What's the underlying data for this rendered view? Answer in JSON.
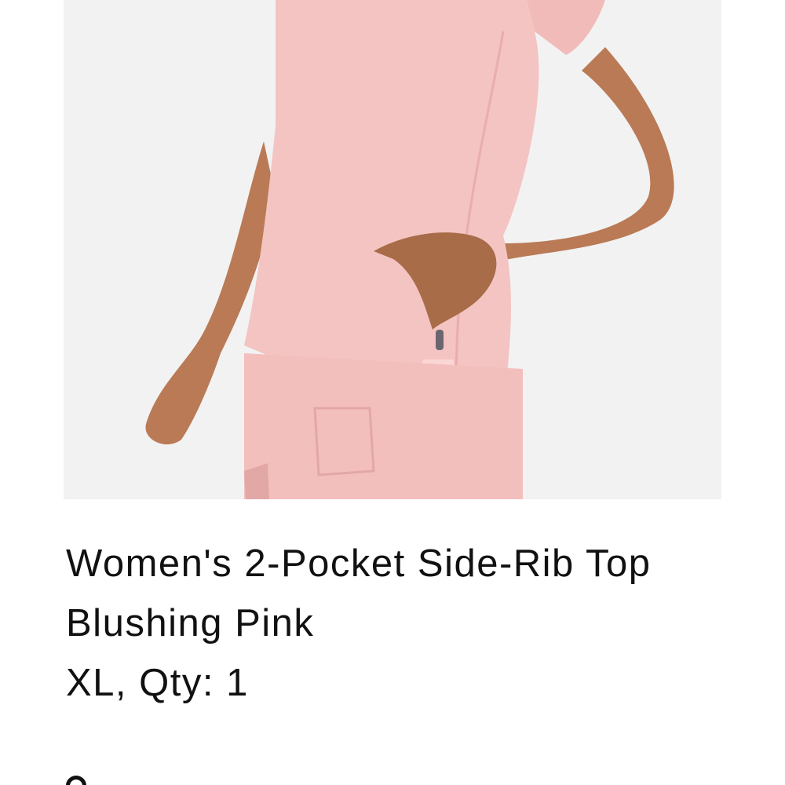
{
  "product": {
    "title": "Women's 2-Pocket Side-Rib Top",
    "color": "Blushing Pink",
    "size_qty": "XL, Qty: 1"
  },
  "colors": {
    "scrub_pink": "#f4c4c2",
    "background": "#f2f2f3",
    "skin": "#b97a55",
    "text": "#111111"
  }
}
